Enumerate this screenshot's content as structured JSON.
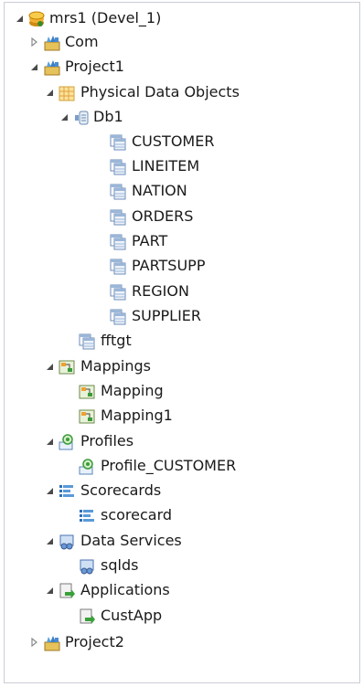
{
  "tree": {
    "root": {
      "label": "mrs1 (Devel_1)",
      "expanded": true,
      "icon": "repository-icon"
    },
    "com": {
      "label": "Com",
      "expanded": false,
      "icon": "project-icon"
    },
    "project1": {
      "label": "Project1",
      "expanded": true,
      "icon": "project-icon"
    },
    "physical_data_objects": {
      "label": "Physical Data Objects",
      "expanded": true,
      "icon": "folder-icon"
    },
    "db1": {
      "label": "Db1",
      "expanded": true,
      "icon": "database-icon"
    },
    "db1_tables": [
      {
        "label": "CUSTOMER"
      },
      {
        "label": "LINEITEM"
      },
      {
        "label": "NATION"
      },
      {
        "label": "ORDERS"
      },
      {
        "label": "PART"
      },
      {
        "label": "PARTSUPP"
      },
      {
        "label": "REGION"
      },
      {
        "label": "SUPPLIER"
      }
    ],
    "fftgt": {
      "label": "fftgt",
      "icon": "table-icon"
    },
    "mappings": {
      "label": "Mappings",
      "expanded": true,
      "icon": "mapping-icon",
      "items": [
        {
          "label": "Mapping"
        },
        {
          "label": "Mapping1"
        }
      ]
    },
    "profiles": {
      "label": "Profiles",
      "expanded": true,
      "icon": "profile-icon",
      "items": [
        {
          "label": "Profile_CUSTOMER"
        }
      ]
    },
    "scorecards": {
      "label": "Scorecards",
      "expanded": true,
      "icon": "scorecard-icon",
      "items": [
        {
          "label": "scorecard"
        }
      ]
    },
    "data_services": {
      "label": "Data Services",
      "expanded": true,
      "icon": "data-service-icon",
      "items": [
        {
          "label": "sqlds"
        }
      ]
    },
    "applications": {
      "label": "Applications",
      "expanded": true,
      "icon": "application-icon",
      "items": [
        {
          "label": "CustApp"
        }
      ]
    },
    "project2": {
      "label": "Project2",
      "expanded": false,
      "icon": "project-icon"
    }
  }
}
